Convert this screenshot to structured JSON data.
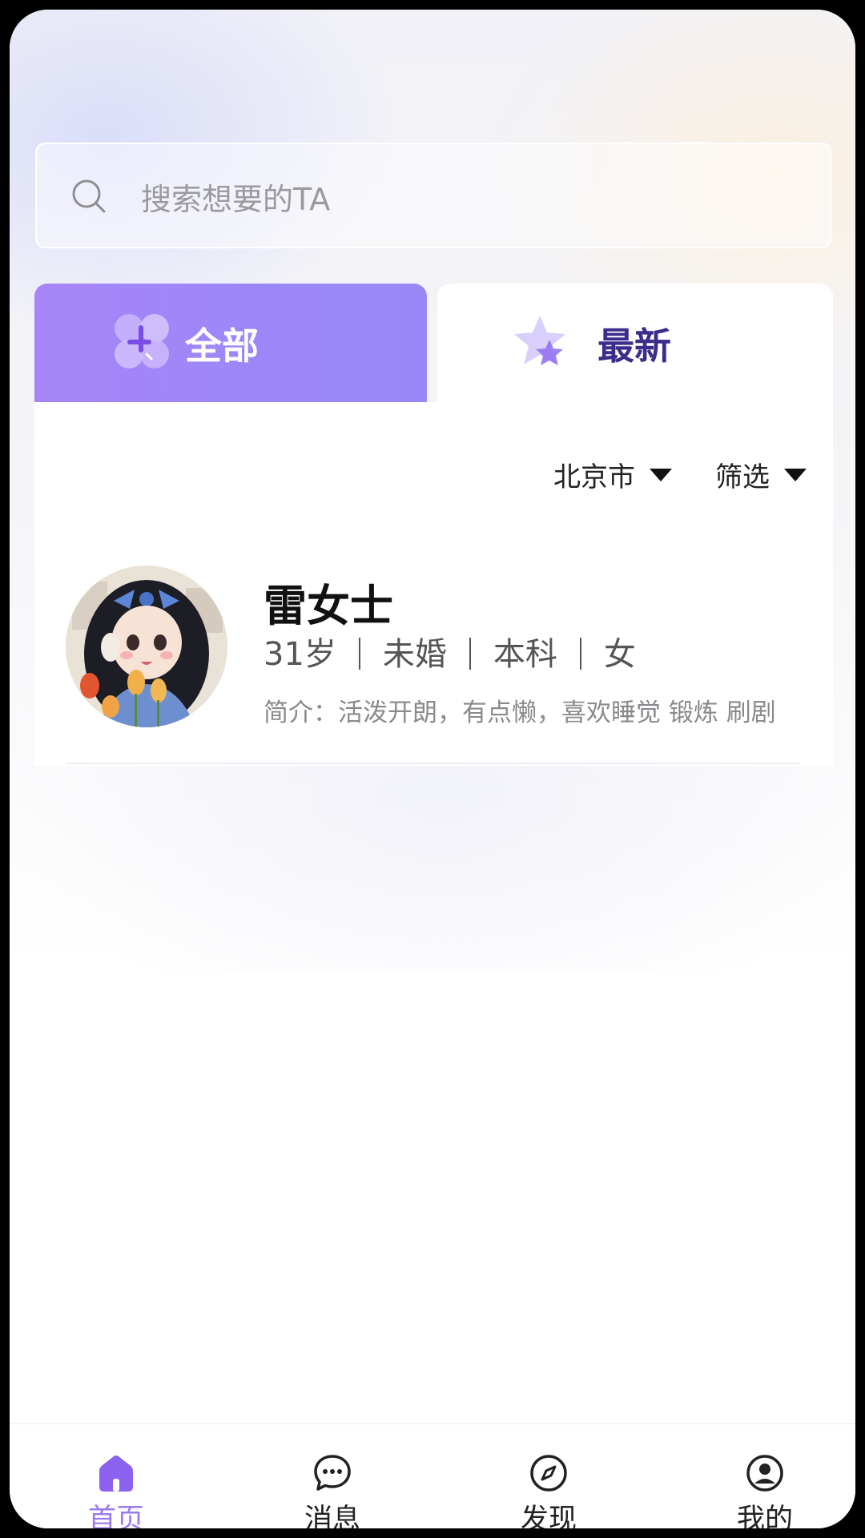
{
  "search": {
    "placeholder": "搜索想要的TA",
    "icon": "search-icon"
  },
  "tabs": [
    {
      "label": "全部",
      "icon": "clover-icon",
      "active": true,
      "color": "#a686f6"
    },
    {
      "label": "最新",
      "icon": "star-icon",
      "active": false,
      "color": "#3c2c8c"
    }
  ],
  "filters": {
    "city": "北京市",
    "screen": "筛选"
  },
  "profile": {
    "name": "雷女士",
    "age": "31岁",
    "marital": "未婚",
    "education": "本科",
    "gender": "女",
    "intro": "简介：活泼开朗，有点懒，喜欢睡觉 锻炼 刷剧"
  },
  "bottom_nav": [
    {
      "label": "首页",
      "icon": "home-icon",
      "active": true
    },
    {
      "label": "消息",
      "icon": "chat-icon",
      "active": false
    },
    {
      "label": "发现",
      "icon": "compass-icon",
      "active": false
    },
    {
      "label": "我的",
      "icon": "user-icon",
      "active": false
    }
  ],
  "colors": {
    "accent": "#9c79ee",
    "tab_active_bg": "#a686f6"
  }
}
